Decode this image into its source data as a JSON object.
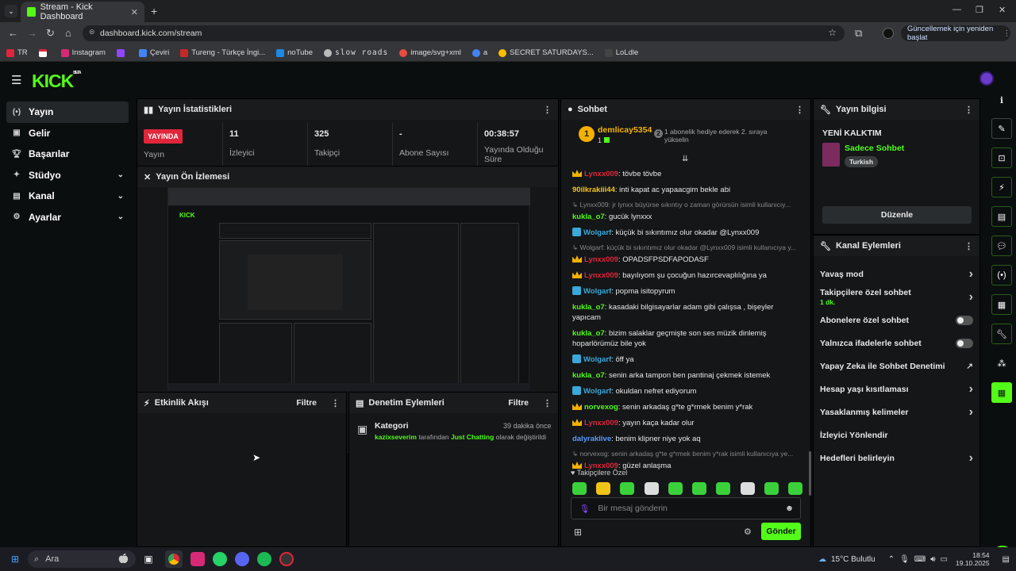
{
  "browser": {
    "tab_title": "Stream - Kick Dashboard",
    "url": "dashboard.kick.com/stream",
    "update_button": "Güncellemek için yeniden başlat",
    "bookmarks": [
      "TR",
      "",
      "Instagram",
      "",
      "Çeviri",
      "Tureng - Türkçe İngi...",
      "noTube",
      "slow roads",
      "image/svg+xml",
      "a",
      "SECRET SATURDAYS...",
      "LoLdle"
    ]
  },
  "app": {
    "logo": "KICK",
    "logo_sup": "BETA",
    "sidebar": [
      {
        "label": "Yayın",
        "icon": "broadcast-icon",
        "active": true,
        "chevron": false
      },
      {
        "label": "Gelir",
        "icon": "money-icon",
        "active": false,
        "chevron": false
      },
      {
        "label": "Başarılar",
        "icon": "trophy-icon",
        "active": false,
        "chevron": false
      },
      {
        "label": "Stüdyo",
        "icon": "studio-icon",
        "active": false,
        "chevron": true
      },
      {
        "label": "Kanal",
        "icon": "channel-icon",
        "active": false,
        "chevron": true
      },
      {
        "label": "Ayarlar",
        "icon": "gear-icon",
        "active": false,
        "chevron": true
      }
    ]
  },
  "stats": {
    "title": "Yayın İstatistikleri",
    "live_badge": "YAYINDA",
    "items": [
      {
        "value": "",
        "label": "Yayın"
      },
      {
        "value": "11",
        "label": "İzleyici"
      },
      {
        "value": "325",
        "label": "Takipçi"
      },
      {
        "value": "-",
        "label": "Abone Sayısı"
      },
      {
        "value": "00:38:57",
        "label": "Yayında Olduğu Süre"
      }
    ]
  },
  "preview": {
    "title": "Yayın Ön İzlemesi"
  },
  "activity": {
    "title": "Etkinlik Akışı",
    "filter": "Filtre"
  },
  "moderation": {
    "title": "Denetim Eylemleri",
    "filter": "Filtre",
    "item_title": "Kategori",
    "item_time": "39 dakika önce",
    "item_user": "kazixseverim",
    "item_mid": "tarafından",
    "item_cat": "Just Chatting",
    "item_end": "olarak değiştirildi"
  },
  "chat": {
    "title": "Sohbet",
    "top_user": "demlicay5354",
    "top_count": "1",
    "top_rank": "1",
    "top_gift_rank": "2",
    "top_gift_text": "1 abonelik hediye ederek 2. sıraya yükselin",
    "messages": [
      {
        "type": "msg",
        "badge": "crown",
        "user": "Lynxx009",
        "color": "#e0263b",
        "text": ": tövbe tövbe"
      },
      {
        "type": "msg",
        "badge": "",
        "user": "90ilkrakiii44",
        "color": "#f5c518",
        "text": ": inti kapat ac yapaacgim bekle abi"
      },
      {
        "type": "reply",
        "text": "↳ Lynxx009: jr lynxx büyürse sıkıntıy o zaman görürsün isimli kullanıcıy..."
      },
      {
        "type": "msg",
        "badge": "",
        "user": "kukla_o7",
        "color": "#53fc18",
        "text": ": gucük lynxxx"
      },
      {
        "type": "msg",
        "badge": "blue",
        "user": "Wolgarf",
        "color": "#3aa8d8",
        "text": ": küçük bi sıkıntımız olur okadar @Lynxx009"
      },
      {
        "type": "reply",
        "text": "↳ Wolgarf: küçük bi sıkıntımız olur okadar @Lynxx009 isimli kullanıcıya y..."
      },
      {
        "type": "msg",
        "badge": "crown",
        "user": "Lynxx009",
        "color": "#e0263b",
        "text": ": OPADSFPSDFAPODASF"
      },
      {
        "type": "msg",
        "badge": "crown",
        "user": "Lynxx009",
        "color": "#e0263b",
        "text": ": bayılıyom şu çocuğun hazırcevaplılığına ya"
      },
      {
        "type": "msg",
        "badge": "blue",
        "user": "Wolgarf",
        "color": "#3aa8d8",
        "text": ": popma isitopyrum"
      },
      {
        "type": "msg",
        "badge": "",
        "user": "kukla_o7",
        "color": "#53fc18",
        "text": ": kasadaki bilgisayarlar adam gibi çalışsa , bişeyler yapıcam"
      },
      {
        "type": "msg",
        "badge": "",
        "user": "kukla_o7",
        "color": "#53fc18",
        "text": ": bizim salaklar geçmişte son ses müzik dinlemiş hoparlörümüz bile yok"
      },
      {
        "type": "msg",
        "badge": "blue",
        "user": "Wolgarf",
        "color": "#3aa8d8",
        "text": ": öff ya"
      },
      {
        "type": "msg",
        "badge": "",
        "user": "kukla_o7",
        "color": "#53fc18",
        "text": ": senin arka tampon ben pantinaj çekmek istemek"
      },
      {
        "type": "msg",
        "badge": "blue",
        "user": "Wolgarf",
        "color": "#3aa8d8",
        "text": ": okuldan nefret ediyorum"
      },
      {
        "type": "msg",
        "badge": "crown",
        "user": "norvexog",
        "color": "#53fc18",
        "text": ": senin arkadaş g*te g*rmek benim y*rak"
      },
      {
        "type": "msg",
        "badge": "crown",
        "user": "Lynxx009",
        "color": "#e0263b",
        "text": ": yayın kaça kadar olur"
      },
      {
        "type": "msg",
        "badge": "",
        "user": "dalyraklive",
        "color": "#5b9bff",
        "text": ": benim klipner niye yok aq"
      },
      {
        "type": "reply",
        "text": "↳ norvexog: senin arkadaş g*te g*rmek benim y*rak isimli kullanıcıya ye..."
      },
      {
        "type": "msg",
        "badge": "crown",
        "user": "Lynxx009",
        "color": "#e0263b",
        "text": ": güzel anlaşma"
      }
    ],
    "followers_only": "Takipçilere Özel",
    "input_placeholder": "Bir mesaj gönderin",
    "send": "Gönder"
  },
  "stream_info": {
    "title": "Yayın bilgisi",
    "stream_title": "YENİ KALKTIM",
    "category": "Sadece Sohbet",
    "tag": "Turkish",
    "edit": "Düzenle"
  },
  "channel_actions": {
    "title": "Kanal Eylemleri",
    "rows": [
      {
        "label": "Yavaş mod",
        "sub": "",
        "control": "chevron"
      },
      {
        "label": "Takipçilere özel sohbet",
        "sub": "1 dk.",
        "control": "chevron"
      },
      {
        "label": "Abonelere özel sohbet",
        "sub": "",
        "control": "toggle"
      },
      {
        "label": "Yalnızca ifadelerle sohbet",
        "sub": "",
        "control": "toggle"
      },
      {
        "label": "Yapay Zeka ile Sohbet Denetimi",
        "sub": "",
        "control": "external"
      },
      {
        "label": "Hesap yaşı kısıtlaması",
        "sub": "",
        "control": "chevron"
      },
      {
        "label": "Yasaklanmış kelimeler",
        "sub": "",
        "control": "chevron"
      },
      {
        "label": "İzleyici Yönlendir",
        "sub": "",
        "control": "none"
      },
      {
        "label": "Hedefleri belirleyin",
        "sub": "",
        "control": "chevron"
      }
    ]
  },
  "taskbar": {
    "search": "Ara",
    "weather": "15°C Bulutlu",
    "time": "18:54",
    "date": "19.10.2025"
  },
  "colors": {
    "accent": "#53fc18",
    "live": "#e0263b",
    "bg": "#0b0e0f",
    "panel": "#141618"
  }
}
